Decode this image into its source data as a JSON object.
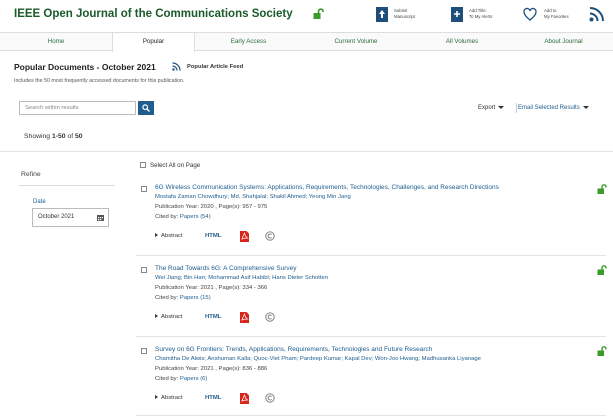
{
  "header": {
    "journal_title": "IEEE Open Journal of the Communications Society",
    "actions": [
      {
        "line1": "Submit",
        "line2": "Manuscript",
        "icon": "upload-doc-icon"
      },
      {
        "line1": "Add Title",
        "line2": "To My Alerts",
        "icon": "alert-doc-icon"
      },
      {
        "line1": "Add to",
        "line2": "My Favorites",
        "icon": "heart-icon"
      }
    ],
    "rss_icon": "rss-icon"
  },
  "nav": {
    "tabs": [
      "Home",
      "Popular",
      "Early Access",
      "Current Volume",
      "All Volumes",
      "About Journal"
    ],
    "active": "Popular"
  },
  "page": {
    "title": "Popular Documents - October 2021",
    "feed_label": "Popular Article Feed",
    "description": "Includes the 50 most frequently accessed documents for this publication."
  },
  "search": {
    "placeholder": "Search within results"
  },
  "toolbar": {
    "export_label": "Export",
    "email_label": "Email Selected Results"
  },
  "showing": {
    "prefix": "Showing",
    "range": "1-50",
    "of": "of",
    "total": "50"
  },
  "refine": {
    "title": "Refine",
    "date_label": "Date",
    "date_value": "October 2021"
  },
  "results_list": {
    "select_all_label": "Select All on Page",
    "items": [
      {
        "title": "6G Wireless Communication Systems: Applications, Requirements, Technologies, Challenges, and Research Directions",
        "authors": "Mostafa Zaman Chowdhury; Md. Shahjalal; Shakil Ahmed; Yeong Min Jang",
        "pub": "Publication Year: 2020 , Page(s): 957 - 975",
        "cited_prefix": "Cited by:",
        "cited_link": "Papers (54)",
        "abstract": "Abstract",
        "html": "HTML"
      },
      {
        "title": "The Road Towards 6G: A Comprehensive Survey",
        "authors": "Wei Jiang; Bin Han; Mohammad Asif Habibi; Hans Dieter Schotten",
        "pub": "Publication Year: 2021 , Page(s): 334 - 366",
        "cited_prefix": "Cited by:",
        "cited_link": "Papers (15)",
        "abstract": "Abstract",
        "html": "HTML"
      },
      {
        "title": "Survey on 6G Frontiers: Trends, Applications, Requirements, Technologies and Future Research",
        "authors": "Chamitha De Alwis; Anshuman Kalla; Quoc-Viet Pham; Pardeep Kumar; Kapal Dev; Won-Joo Hwang; Madhusanka Liyanage",
        "pub": "Publication Year: 2021 , Page(s): 836 - 886",
        "cited_prefix": "Cited by:",
        "cited_link": "Papers (6)",
        "abstract": "Abstract",
        "html": "HTML"
      }
    ]
  },
  "colors": {
    "brand_green": "#1a5a2a",
    "link_blue": "#1e5d8e",
    "open_access_green": "#3a9a2a",
    "pdf_red": "#d9261c"
  }
}
